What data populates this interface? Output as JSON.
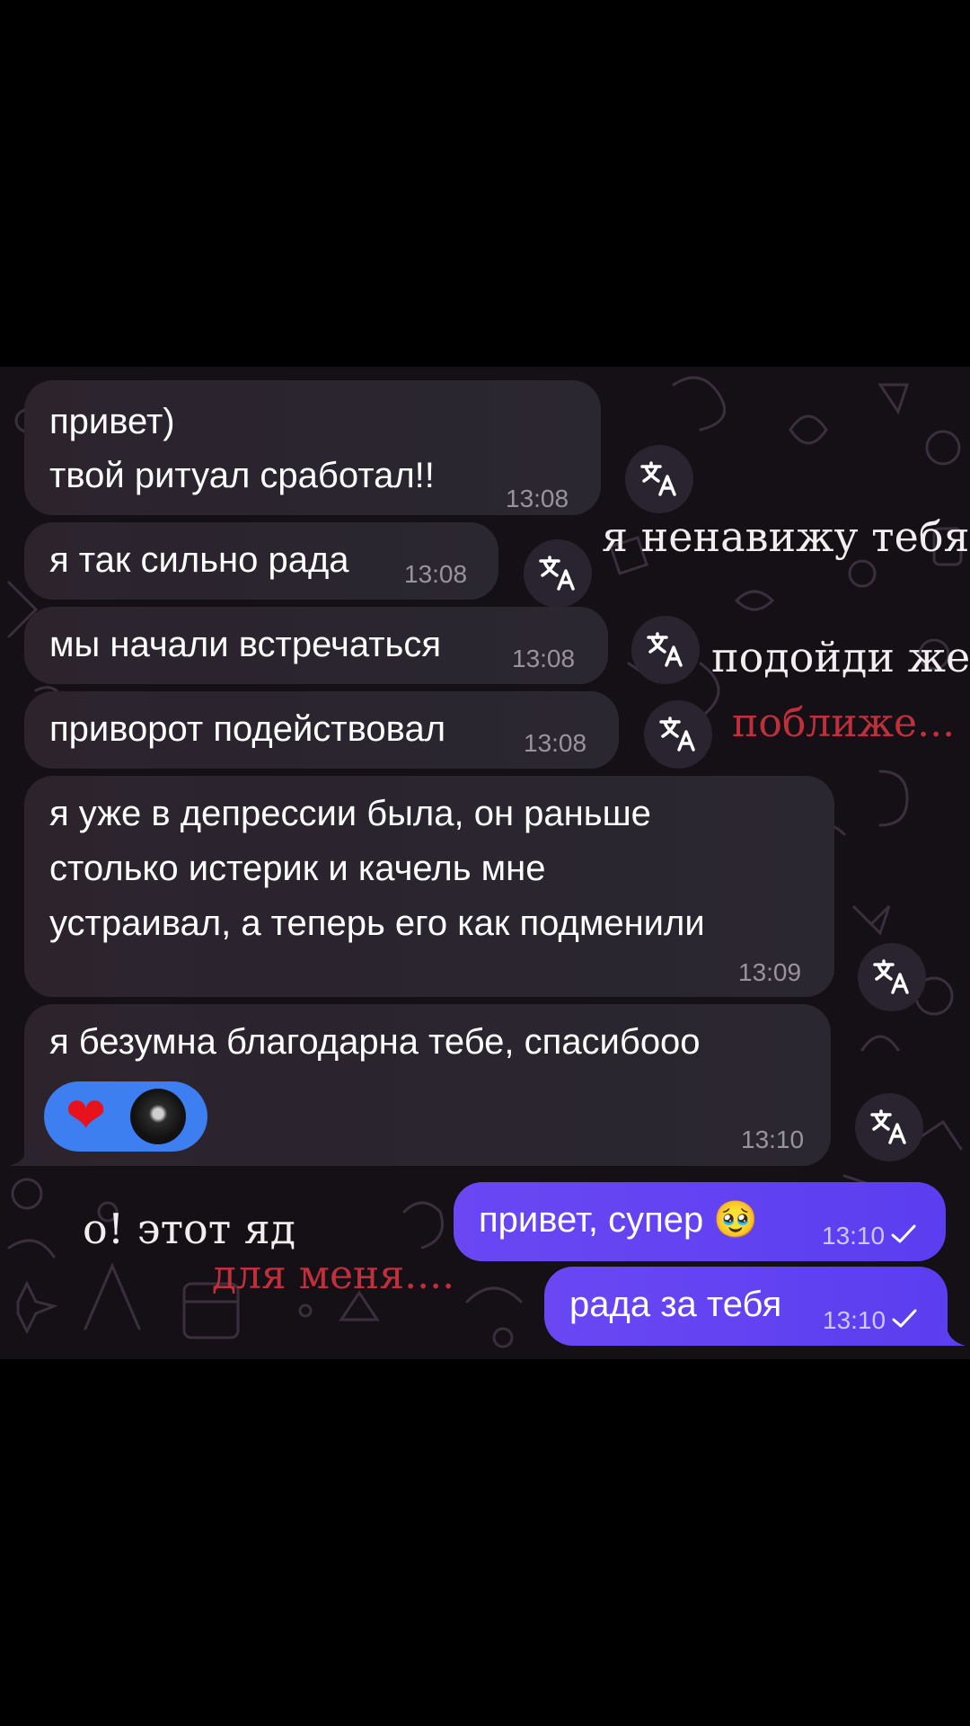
{
  "messages": [
    {
      "lines": [
        "привет)",
        "твой ритуал сработал!!"
      ],
      "time": "13:08"
    },
    {
      "lines": [
        "я так сильно рада"
      ],
      "time": "13:08"
    },
    {
      "lines": [
        "мы начали встречаться"
      ],
      "time": "13:08"
    },
    {
      "lines": [
        "приворот подействовал"
      ],
      "time": "13:08"
    },
    {
      "lines": [
        "я уже в депрессии была, он раньше",
        "столько истерик и качель мне",
        "устраивал, а теперь его как подменили"
      ],
      "time": "13:09"
    },
    {
      "lines": [
        "я безумна благодарна тебе, спасибооо"
      ],
      "time": "13:10"
    }
  ],
  "outgoing": [
    {
      "text": "привет, супер 🥹",
      "time": "13:10"
    },
    {
      "text": "рада за тебя",
      "time": "13:10"
    }
  ],
  "overlay_text": {
    "line1": "я ненавижу тебя",
    "line2": "подойди же",
    "line3": "поближе...",
    "line4": "о! этот яд",
    "line5": "для меня...."
  },
  "colors": {
    "incoming_bubble": "#2a242e",
    "outgoing_bubble": "#6246f2",
    "reaction_pill": "#3d7ef0",
    "accent_red": "#c0303c"
  },
  "icons": {
    "translate": "translate-icon",
    "read_receipt": "check-icon",
    "reaction": "heart-icon"
  },
  "reaction": {
    "emoji": "❤"
  }
}
